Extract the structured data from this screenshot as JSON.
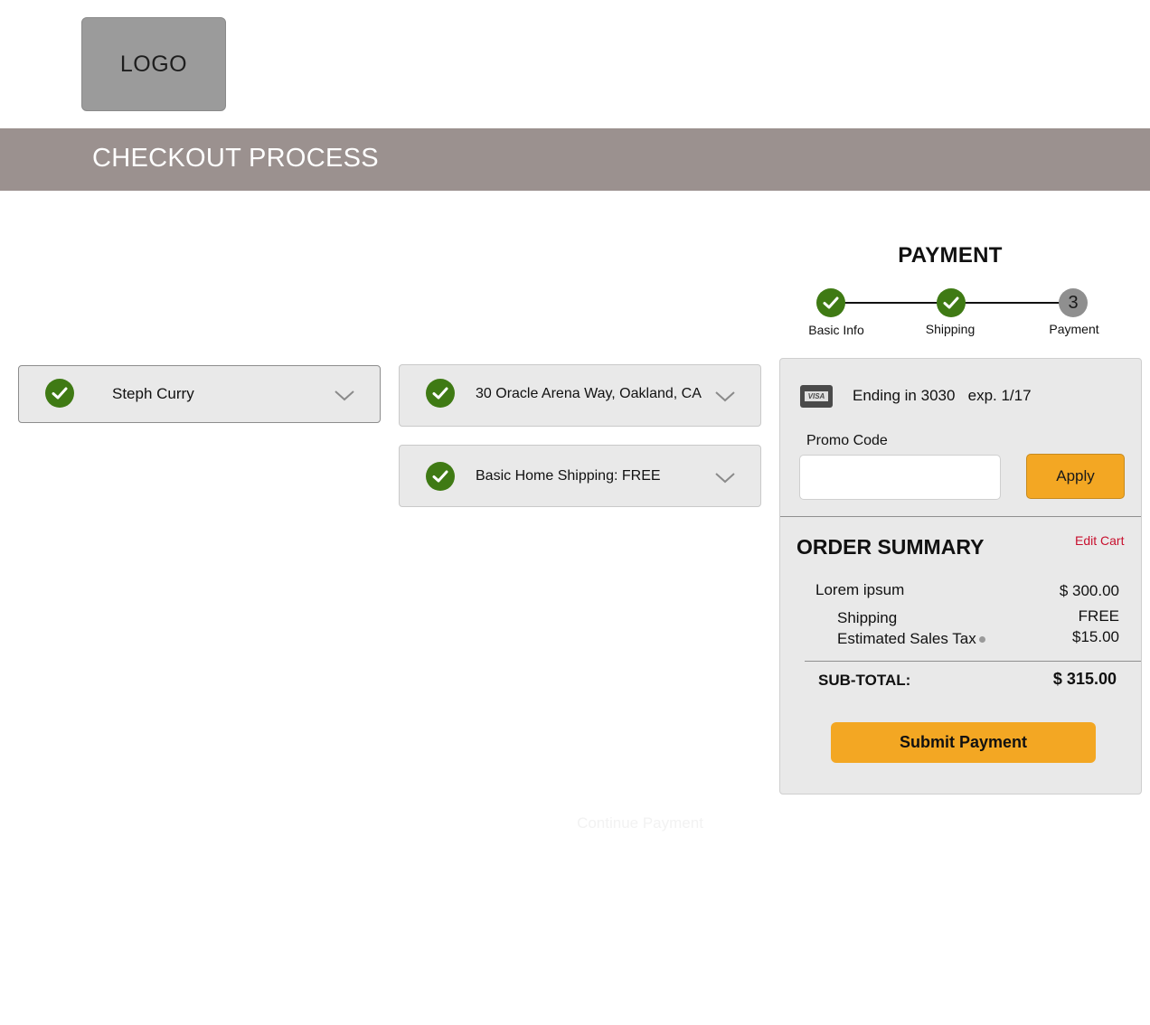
{
  "header": {
    "logo_text": "LOGO"
  },
  "banner": {
    "title": "CHECKOUT PROCESS"
  },
  "progress": {
    "heading": "PAYMENT",
    "steps": [
      {
        "label": "Basic Info",
        "status": "complete"
      },
      {
        "label": "Shipping",
        "status": "complete"
      },
      {
        "label": "Payment",
        "status": "current",
        "number": "3"
      }
    ]
  },
  "sections": {
    "basic_info": {
      "value": "Steph Curry",
      "status_icon": "check-icon"
    },
    "address": {
      "value": "30 Oracle Arena Way, Oakland, CA",
      "status_icon": "check-icon"
    },
    "shipping_method": {
      "value": "Basic Home Shipping: FREE",
      "status_icon": "check-icon"
    }
  },
  "payment": {
    "card_icon": "visa-card-icon",
    "card_text": "Ending in 3030",
    "card_exp": "exp. 1/17",
    "promo_label": "Promo Code",
    "promo_value": "",
    "apply_label": "Apply"
  },
  "summary": {
    "title": "ORDER SUMMARY",
    "edit_cart": "Edit Cart",
    "item_name": "Lorem ipsum",
    "item_price": "$ 300.00",
    "shipping_label": "Shipping",
    "shipping_value": "FREE",
    "tax_label": "Estimated Sales Tax",
    "tax_value": "$15.00",
    "subtotal_label": "SUB-TOTAL:",
    "subtotal_value": "$ 315.00",
    "submit_label": "Submit Payment"
  },
  "footer": {
    "continue_label": "Continue Payment"
  },
  "colors": {
    "accent": "#f3a723",
    "success": "#3f7a14",
    "banner": "#9b918f",
    "panel": "#e9e9e9",
    "edit_link": "#c8102e"
  }
}
